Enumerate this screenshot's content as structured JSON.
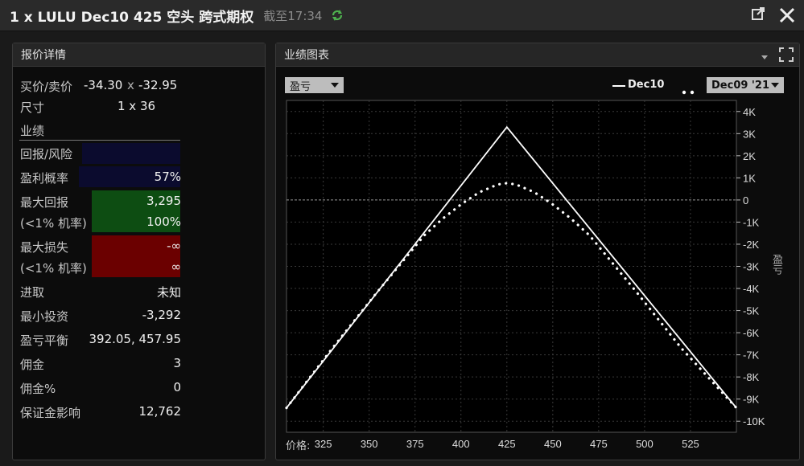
{
  "window": {
    "title": "1 x LULU Dec10 425 空头 跨式期权",
    "as_of": "截至17:34"
  },
  "quote_panel": {
    "title": "报价详情",
    "bid_ask_label": "买价/卖价",
    "bid": "-34.30",
    "ask_sep": "x",
    "ask": "-32.95",
    "size_label": "尺寸",
    "size_value": "1 x 36",
    "performance_label": "业绩",
    "return_risk_label": "回报/风险",
    "prob_profit_label": "盈利概率",
    "prob_profit_value": "57%",
    "max_return_label": "最大回报",
    "max_return_value": "3,295",
    "max_return_prob_label": "(<1% 机率)",
    "max_return_prob_value": "100%",
    "max_loss_label": "最大损失",
    "max_loss_value": "-∞",
    "max_loss_prob_label": "(<1% 机率)",
    "max_loss_prob_value": "∞",
    "entry_label": "进取",
    "entry_value": "未知",
    "min_invest_label": "最小投资",
    "min_invest_value": "-3,292",
    "breakeven_label": "盈亏平衡",
    "breakeven_value": "392.05, 457.95",
    "commission_label": "佣金",
    "commission_value": "3",
    "commission_pct_label": "佣金%",
    "commission_pct_value": "0",
    "margin_label": "保证金影响",
    "margin_value": "12,762"
  },
  "chart_panel": {
    "title": "业绩图表",
    "metric_select": "盈亏",
    "legend_solid": "Dec10",
    "date_select": "Dec09 '21",
    "price_label": "价格:",
    "y_axis_title": "盈亏"
  },
  "colors": {
    "return_risk_bg": "#0b0b2e",
    "prob_bg": "#0b0b2e",
    "max_return_bg": "#0d4d12",
    "max_loss_bg": "#6b0000"
  },
  "chart_data": {
    "type": "line",
    "xlabel": "价格:",
    "ylabel": "盈亏",
    "x_ticks": [
      325,
      350,
      375,
      400,
      425,
      450,
      475,
      500,
      525
    ],
    "y_ticks": [
      4000,
      3000,
      2000,
      1000,
      0,
      -1000,
      -2000,
      -3000,
      -4000,
      -5000,
      -6000,
      -7000,
      -8000,
      -9000,
      -10000
    ],
    "y_tick_labels": [
      "4K",
      "3K",
      "2K",
      "1K",
      "0",
      "-1K",
      "-2K",
      "-3K",
      "-4K",
      "-5K",
      "-6K",
      "-7K",
      "-8K",
      "-9K",
      "-10K"
    ],
    "xlim": [
      305,
      550
    ],
    "ylim": [
      -10500,
      4500
    ],
    "grid": true,
    "series": [
      {
        "name": "Dec10",
        "style": "solid",
        "x": [
          305,
          425,
          550
        ],
        "y": [
          -9400,
          3295,
          -9400
        ]
      },
      {
        "name": "Dec09 '21",
        "style": "dotted",
        "x": [
          305,
          330,
          355,
          380,
          390,
          400,
          410,
          420,
          425,
          430,
          440,
          450,
          460,
          470,
          495,
          520,
          550
        ],
        "y": [
          -9400,
          -6700,
          -4100,
          -1600,
          -850,
          -200,
          350,
          700,
          760,
          700,
          350,
          -200,
          -850,
          -1600,
          -4100,
          -6700,
          -9400
        ]
      }
    ]
  }
}
